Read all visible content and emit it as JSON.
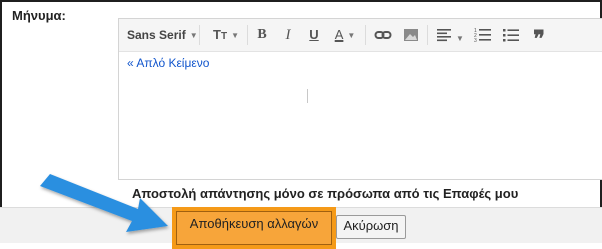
{
  "message_label": "Μήνυμα:",
  "toolbar": {
    "font": "Sans Serif",
    "size_icon": "text-size-icon",
    "bold": "B",
    "italic": "I",
    "underline": "U",
    "text_color": "A",
    "link_icon": "link-icon",
    "image_icon": "image-icon",
    "align_icon": "align-icon",
    "numbered_list_icon": "numbered-list-icon",
    "bulleted_list_icon": "bulleted-list-icon",
    "quote_icon": "quote-icon"
  },
  "plain_text_link": "« Απλό Κείμενο",
  "reply_option": "Αποστολή απάντησης μόνο σε πρόσωπα από τις Επαφές μου",
  "buttons": {
    "save": "Αποθήκευση αλλαγών",
    "cancel": "Ακύρωση"
  },
  "colors": {
    "highlight": "#f59a18",
    "arrow": "#2b8fe0",
    "link": "#1155cc"
  }
}
